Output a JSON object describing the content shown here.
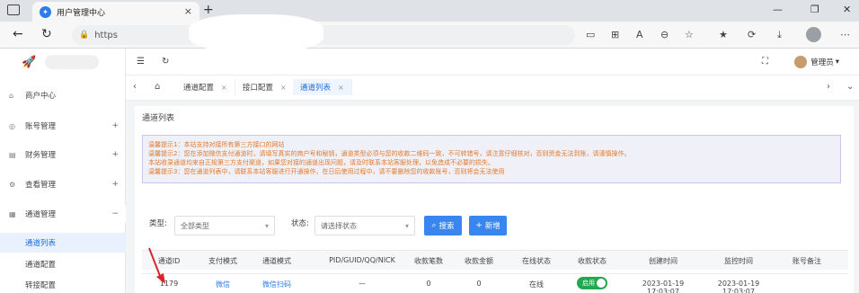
{
  "browser": {
    "tab_title": "用户管理中心",
    "tab_close": "×",
    "new_tab": "+",
    "url_prefix": "https",
    "back": "←",
    "reload": "↻"
  },
  "sidebar": {
    "items": [
      {
        "label": "商户中心",
        "icon": "home-icon",
        "arrow": ""
      },
      {
        "label": "账号管理",
        "icon": "user-icon",
        "arrow": "+"
      },
      {
        "label": "财务管理",
        "icon": "wallet-icon",
        "arrow": "+"
      },
      {
        "label": "查看管理",
        "icon": "settings-icon",
        "arrow": "+"
      },
      {
        "label": "通道管理",
        "icon": "channel-icon",
        "arrow": "−"
      }
    ],
    "subitems": [
      {
        "label": "通道列表"
      },
      {
        "label": "通道配置"
      },
      {
        "label": "转接配置"
      }
    ]
  },
  "topbar": {
    "admin_label": "管理员",
    "admin_caret": "▾"
  },
  "page_tabs": [
    {
      "label": "通道配置"
    },
    {
      "label": "接口配置"
    },
    {
      "label": "通道列表"
    }
  ],
  "main": {
    "section_title": "通道列表",
    "notice_lines": [
      "温馨提示1：本站支持对接所有第三方接口的网站",
      "温馨提示2：您在添加微信支付通道时，请填写真实的商户号和秘钥，通道类型必须与您的收款二维码一致，不可转错号，请注意仔细核对，否则资金无法到账，请谨慎操作。",
      "本站收录通道均来自正规第三方支付渠道，如果您对接的通道出现问题，请及时联系本站客服处理，以免造成不必要的损失。",
      "温馨提示3：您在通道列表中，请联系本站客服进行开通操作，在日后使用过程中，请不要删除您的收款账号，否则将会无法使用"
    ],
    "filters": {
      "type_label": "类型:",
      "type_value": "全部类型",
      "status_label": "状态:",
      "status_value": "请选择状态",
      "search_label": "搜索",
      "add_label": "新增"
    },
    "table": {
      "headers": [
        "通道ID",
        "支付模式",
        "通道模式",
        "PID/GUID/QQ/NICK",
        "收款笔数",
        "收款金额",
        "在线状态",
        "收款状态",
        "创建时间",
        "监控时间",
        "账号备注"
      ],
      "rows": [
        {
          "id": "1179",
          "pay_mode": "微信",
          "channel_mode": "微信扫码",
          "pid": "—",
          "count": "0",
          "amount": "0",
          "online": "在线",
          "status": "启用",
          "created": "2023-01-19 17:03:07",
          "monitored": "2023-01-19 17:03:07",
          "note": ""
        }
      ]
    }
  },
  "colors": {
    "accent": "#3a86f0",
    "notice_text": "#e07b2c",
    "toggle_on": "#22a84e"
  }
}
